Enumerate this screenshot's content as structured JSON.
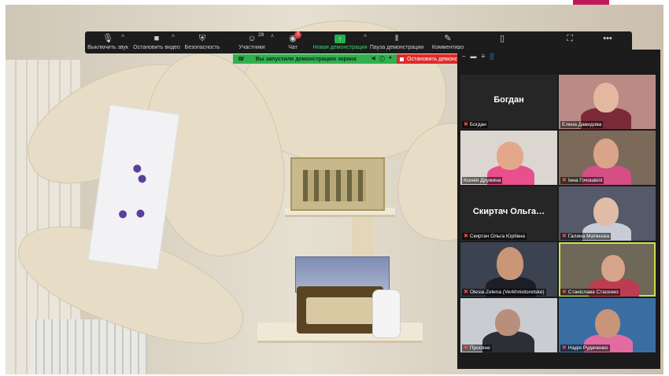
{
  "toolbar": {
    "mute": {
      "label": "Выключить звук",
      "icon": "microphone-icon"
    },
    "video": {
      "label": "Остановить видео",
      "icon": "video-camera-icon"
    },
    "security": {
      "label": "Безопасность",
      "icon": "shield-icon"
    },
    "participants": {
      "label": "Участники",
      "count": "28",
      "icon": "participants-icon"
    },
    "chat": {
      "label": "Чат",
      "badge": "3",
      "icon": "chat-icon"
    },
    "share": {
      "label": "Новая демонстрация",
      "icon": "share-screen-icon"
    },
    "pause": {
      "label": "Пауза демонстрации",
      "icon": "pause-icon"
    },
    "annotate": {
      "label": "Комментиро",
      "icon": "pencil-icon"
    },
    "remote": {
      "icon": "mouse-icon"
    },
    "fullscreen": {
      "icon": "expand-icon"
    },
    "more": {
      "icon": "more-icon"
    }
  },
  "sharing": {
    "status": "Вы запустили демонстрацию экрана",
    "stop_label": "Остановить демонс"
  },
  "gallery": {
    "participants": [
      {
        "name": "Богдан",
        "display": "Богдан",
        "muted": true,
        "video": false
      },
      {
        "name": "Елена Давидова",
        "muted": false,
        "video": true
      },
      {
        "name": "Ксенія Дружина",
        "muted": false,
        "video": true
      },
      {
        "name": "Інна Гочошвілі",
        "muted": true,
        "video": true
      },
      {
        "name": "Скиртач Ольга Юріївна",
        "display": "Скиртач  Ольга…",
        "muted": true,
        "video": false
      },
      {
        "name": "Галина Матвєєва",
        "muted": true,
        "video": true
      },
      {
        "name": "Olesia Zelena (Verkhniotoretske)",
        "muted": true,
        "video": true
      },
      {
        "name": "Станіслава Стасенко",
        "muted": true,
        "video": true,
        "active": true
      },
      {
        "name": "Просяне",
        "muted": true,
        "video": true
      },
      {
        "name": "Надія Рудаченко",
        "muted": true,
        "video": true
      }
    ]
  },
  "colors": {
    "share_green": "#2fb04f",
    "stop_red": "#e02a2a",
    "active_outline": "#c8e24a",
    "toolbar_bg": "#1c1c1c"
  }
}
